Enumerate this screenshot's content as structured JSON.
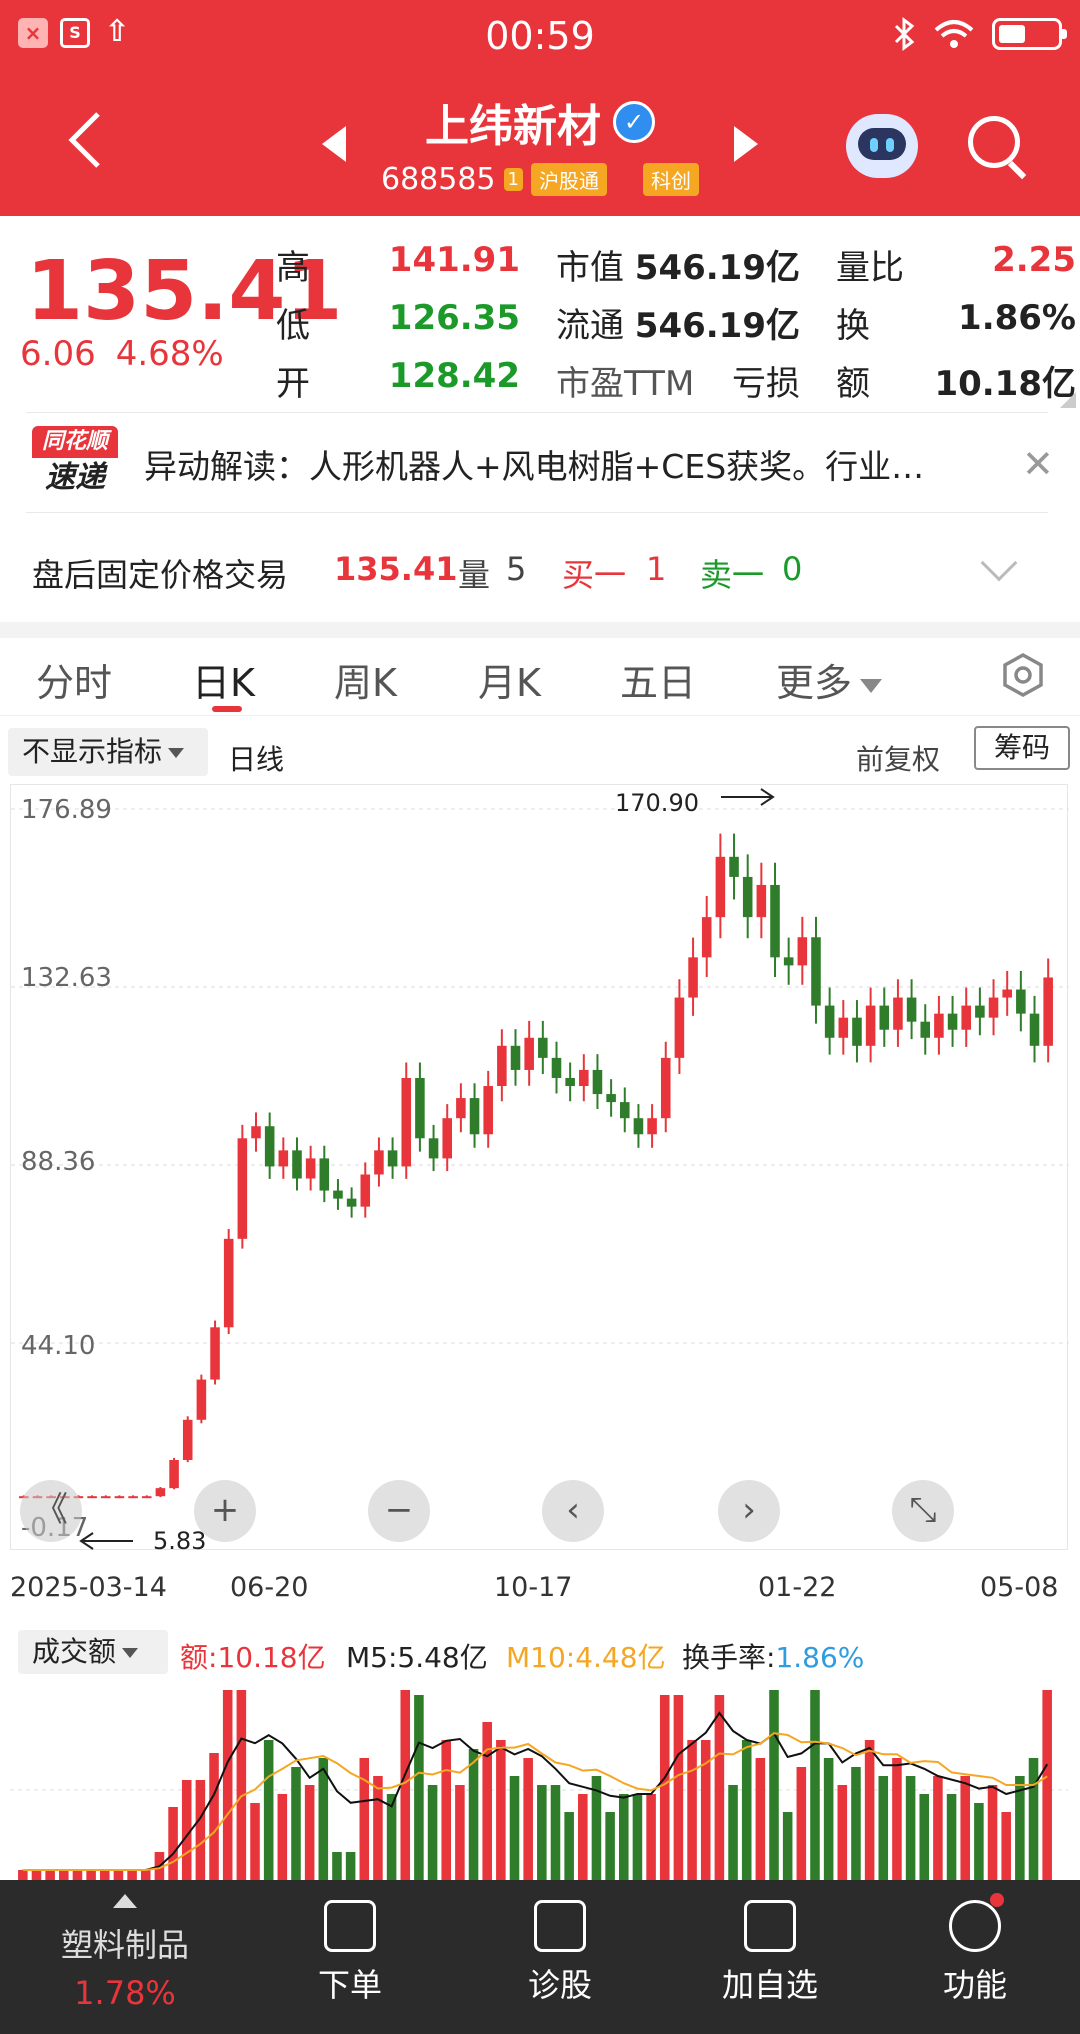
{
  "status_bar": {
    "time": "00:59"
  },
  "header": {
    "stock_name": "上纬新材",
    "code": "688585",
    "tag_small": "1",
    "tag_connect": "沪股通",
    "tag_board": "科创"
  },
  "quote": {
    "price": "135.41",
    "change_abs": "6.06",
    "change_pct": "4.68%",
    "high_label": "高",
    "high_value": "141.91",
    "low_label": "低",
    "low_value": "126.35",
    "open_label": "开",
    "open_value": "128.42",
    "mktcap_label": "市值",
    "mktcap_value": "546.19亿",
    "float_label": "流通",
    "float_value": "546.19亿",
    "pe_label": "市盈TTM",
    "pe_value": "亏损",
    "vr_label": "量比",
    "vr_value": "2.25",
    "turnover_label": "换",
    "turnover_value": "1.86%",
    "amount_label": "额",
    "amount_value": "10.18亿"
  },
  "news": {
    "logo_top": "同花顺",
    "logo_bottom": "速递",
    "text": "异动解读：人形机器人+风电树脂+CES获奖。行业…",
    "close": "✕"
  },
  "after_hours": {
    "label": "盘后固定价格交易",
    "price": "135.41",
    "vol_label": "量",
    "vol_value": "5",
    "buy_label": "买一",
    "buy_value": "1",
    "sell_label": "卖一",
    "sell_value": "0"
  },
  "tabs": [
    {
      "label": "分时"
    },
    {
      "label": "日K"
    },
    {
      "label": "周K"
    },
    {
      "label": "月K"
    },
    {
      "label": "五日"
    },
    {
      "label": "更多"
    }
  ],
  "indicator_row": {
    "indicator": "不显示指标",
    "period": "日线",
    "adjust": "前复权",
    "chips": "筹码"
  },
  "chart_data": {
    "type": "candlestick",
    "y_ticks": [
      "176.89",
      "132.63",
      "88.36",
      "44.10",
      "-0.17"
    ],
    "ylim": [
      -0.17,
      176.89
    ],
    "x_ticks": [
      "2025-03-14",
      "06-20",
      "10-17",
      "01-22",
      "05-08"
    ],
    "annotation_high": "170.90",
    "annotation_low": "5.83",
    "close_series": [
      6,
      6,
      6,
      6,
      6,
      6,
      6,
      6,
      6,
      6,
      8,
      15,
      25,
      35,
      48,
      70,
      95,
      98,
      88,
      92,
      85,
      90,
      82,
      80,
      78,
      86,
      92,
      88,
      110,
      95,
      90,
      100,
      105,
      96,
      108,
      118,
      112,
      120,
      115,
      110,
      108,
      112,
      106,
      104,
      100,
      96,
      100,
      115,
      130,
      140,
      150,
      165,
      160,
      150,
      158,
      140,
      138,
      145,
      128,
      120,
      125,
      118,
      128,
      122,
      130,
      124,
      120,
      126,
      122,
      128,
      125,
      130,
      132,
      126,
      118,
      135
    ]
  },
  "chart_controls": {
    "fast_back": "《",
    "zoom_in": "+",
    "zoom_out": "−",
    "prev": "‹",
    "next": "›",
    "fullscreen": "⤡"
  },
  "volume": {
    "selector": "成交额",
    "amount_label": "额:",
    "amount_value": "10.18亿",
    "m5": "M5:5.48亿",
    "m10": "M10:4.48亿",
    "turnover_label": "换手率:",
    "turnover_value": "1.86%"
  },
  "bottom_bar": {
    "sector_name": "塑料制品",
    "sector_pct": "1.78%",
    "order": "下单",
    "diagnose": "诊股",
    "add_watch": "加自选",
    "function": "功能"
  },
  "colors": {
    "brand_red": "#e8353b",
    "down_green": "#1b9a2a",
    "ma10_orange": "#f5a623",
    "turnover_blue": "#2f9be0"
  }
}
